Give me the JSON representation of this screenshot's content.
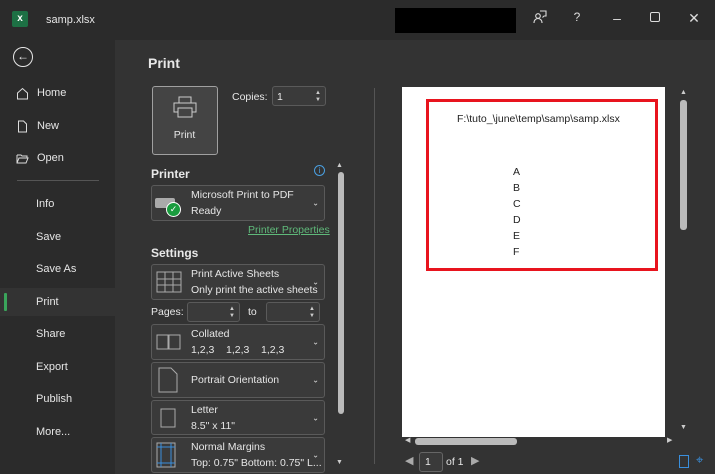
{
  "window": {
    "title": "samp.xlsx"
  },
  "nav": {
    "items": [
      {
        "label": "Home"
      },
      {
        "label": "New"
      },
      {
        "label": "Open"
      },
      {
        "label": "Info"
      },
      {
        "label": "Save"
      },
      {
        "label": "Save As"
      },
      {
        "label": "Print"
      },
      {
        "label": "Share"
      },
      {
        "label": "Export"
      },
      {
        "label": "Publish"
      },
      {
        "label": "More..."
      }
    ],
    "active": "Print"
  },
  "print": {
    "heading": "Print",
    "button_label": "Print",
    "copies_label": "Copies:",
    "copies_value": "1"
  },
  "printer": {
    "heading": "Printer",
    "name": "Microsoft Print to PDF",
    "status": "Ready",
    "properties_link": "Printer Properties"
  },
  "settings": {
    "heading": "Settings",
    "sheets": {
      "title": "Print Active Sheets",
      "subtitle": "Only print the active sheets"
    },
    "pages_label": "Pages:",
    "pages_from": "",
    "to_label": "to",
    "pages_to": "",
    "collate": {
      "title": "Collated",
      "subtitle": "1,2,3    1,2,3    1,2,3"
    },
    "orientation": {
      "title": "Portrait Orientation"
    },
    "paper": {
      "title": "Letter",
      "subtitle": "8.5\" x 11\""
    },
    "margins": {
      "title": "Normal Margins",
      "subtitle": "Top: 0.75\" Bottom: 0.75\" L..."
    }
  },
  "preview": {
    "header_path": "F:\\tuto_\\june\\temp\\samp\\samp.xlsx",
    "cells": [
      "A",
      "B",
      "C",
      "D",
      "E",
      "F"
    ],
    "current_page": "1",
    "page_of": "of 1",
    "highlight_color": "#e8141e"
  },
  "colors": {
    "accent": "#3aa45b",
    "link": "#5fb97a",
    "excel_green": "#1d7044"
  }
}
